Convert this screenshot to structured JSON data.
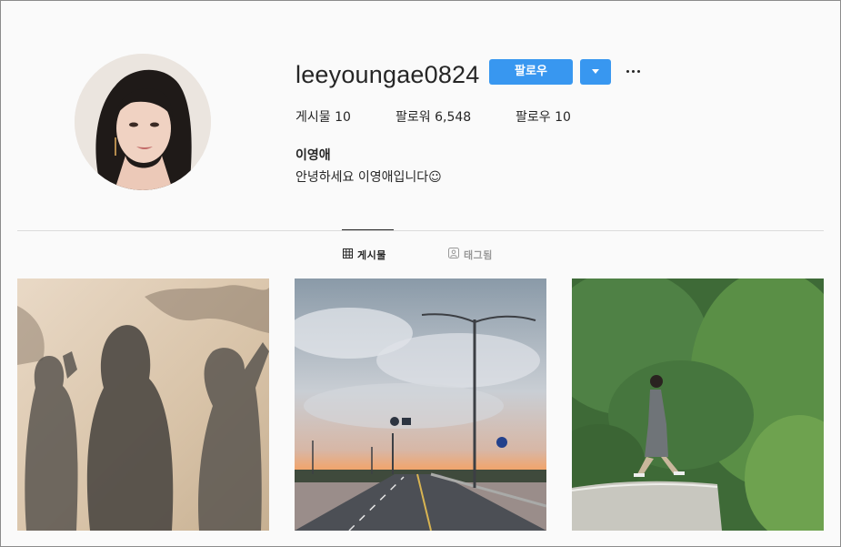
{
  "profile": {
    "username": "leeyoungae0824",
    "full_name": "이영애",
    "bio": "안녕하세요 이영애입니다☺"
  },
  "actions": {
    "follow_label": "팔로우",
    "dropdown_icon": "triangle-down-icon",
    "more_icon": "ellipsis-icon"
  },
  "stats": [
    {
      "label": "게시물",
      "value": "10"
    },
    {
      "label": "팔로워",
      "value": "6,548"
    },
    {
      "label": "팔로우",
      "value": "10"
    }
  ],
  "tabs": [
    {
      "label": "게시물",
      "icon": "grid-icon",
      "active": true
    },
    {
      "label": "태그됨",
      "icon": "tag-icon",
      "active": false
    }
  ],
  "colors": {
    "accent": "#3897f0",
    "text": "#262626",
    "muted": "#999999",
    "border": "#dbdbdb",
    "background": "#fafafa"
  },
  "posts": [
    {
      "subject": "shadows of three people on a wall"
    },
    {
      "subject": "highway at sunset with street lamps"
    },
    {
      "subject": "woman walking on a road by green trees"
    }
  ]
}
